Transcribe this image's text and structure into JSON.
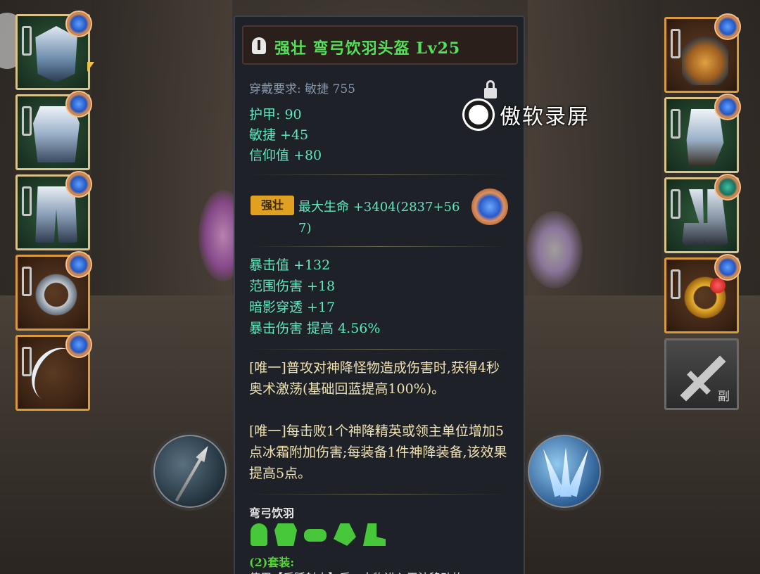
{
  "item": {
    "title": "强壮  弯弓饮羽头盔  Lv25",
    "requirement": "穿戴要求:  敏捷  755",
    "base_stats": [
      "护甲:   90",
      "敏捷  +45",
      "信仰值  +80"
    ],
    "quality_tag": "强壮",
    "quality_bonus": "最大生命  +3404(2837+567)",
    "random_stats": [
      "暴击值  +132",
      "范围伤害  +18",
      "暗影穿透  +17",
      "暴击伤害  提高  4.56%"
    ],
    "unique_effects": [
      "[唯一]普攻对神降怪物造成伤害时,获得4秒奥术激荡(基础回蓝提高100%)。",
      "[唯一]每击败1个神降精英或领主单位增加5点冰霜附加伤害;每装备1件神降装备,该效果提高5点。"
    ],
    "set_name": "弯弓饮羽",
    "set_pieces": [
      "helm-icon",
      "chest-icon",
      "belt-icon",
      "glove-icon",
      "boots-icon"
    ],
    "set_bonus_label": "(2)套装:",
    "set_bonus_text": "使用【后跃射击】后，人物进入无法移动的"
  },
  "weapon_slot": {
    "label": "副"
  },
  "watermark": {
    "text": "傲软录屏"
  },
  "colors": {
    "title_green": "#55e05a",
    "stat_teal": "#5ee8c0",
    "unique_yellow": "#efe2b0",
    "tag_orange": "#e0a020"
  }
}
